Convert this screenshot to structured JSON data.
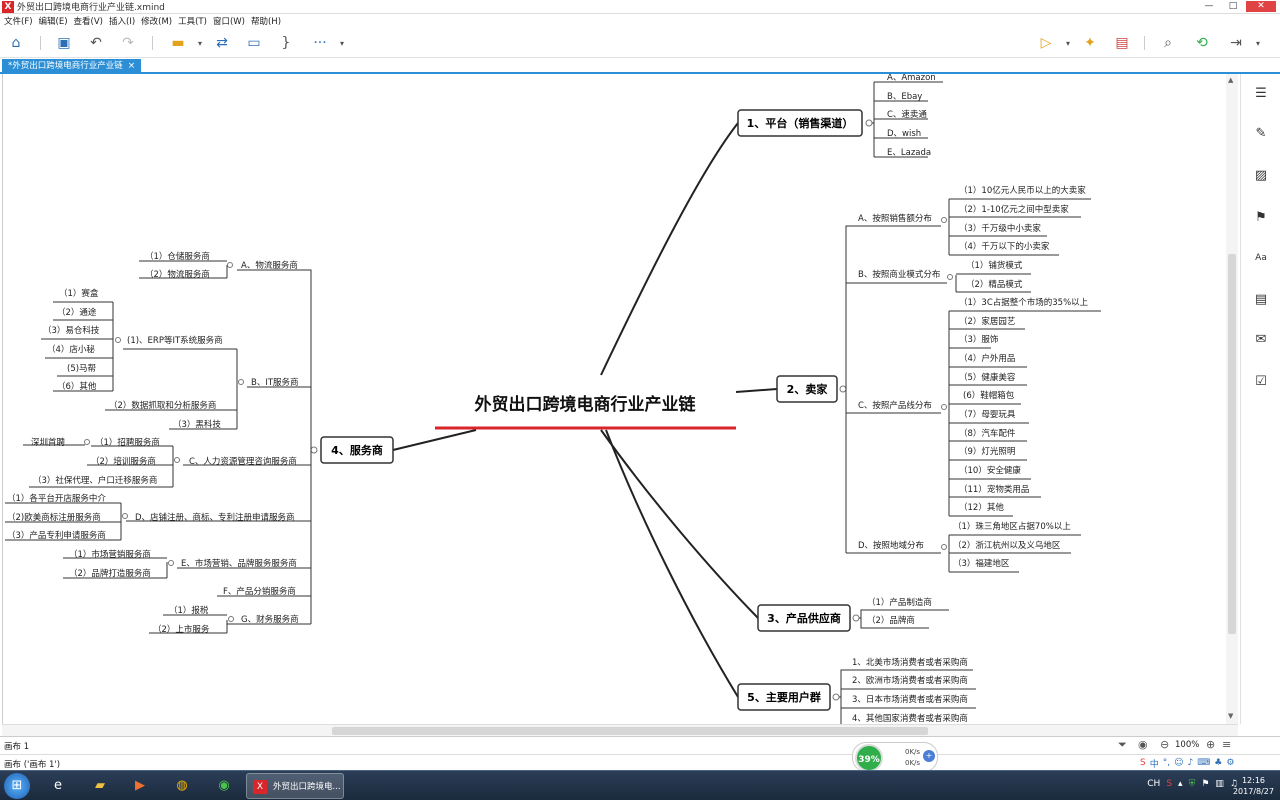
{
  "window": {
    "title": "外贸出口跨境电商行业产业链.xmind",
    "app_icon": "X"
  },
  "menu": [
    "文件(F)",
    "编辑(E)",
    "查看(V)",
    "插入(I)",
    "修改(M)",
    "工具(T)",
    "窗口(W)",
    "帮助(H)"
  ],
  "tab": {
    "label": "*外贸出口跨境电商行业产业链",
    "close": "×"
  },
  "mindmap": {
    "central": "外贸出口跨境电商行业产业链",
    "b1": {
      "label": "1、平台（销售渠道）",
      "items": [
        "A、Amazon",
        "B、Ebay",
        "C、速卖通",
        "D、wish",
        "E、Lazada"
      ]
    },
    "b2": {
      "label": "2、卖家",
      "a": {
        "label": "A、按照销售额分布",
        "items": [
          "（1）10亿元人民币以上的大卖家",
          "（2）1-10亿元之间中型卖家",
          "（3）千万级中小卖家",
          "（4）千万以下的小卖家"
        ]
      },
      "b": {
        "label": "B、按照商业模式分布",
        "items": [
          "（1）铺货模式",
          "（2）精品模式"
        ]
      },
      "c": {
        "label": "C、按照产品线分布",
        "items": [
          "（1）3C占据整个市场的35%以上",
          "（2）家居园艺",
          "（3）服饰",
          "（4）户外用品",
          "（5）健康美容",
          "(6）鞋帽箱包",
          "（7）母婴玩具",
          "（8）汽车配件",
          "（9）灯光照明",
          "（10）安全健康",
          "（11）宠物类用品",
          "（12）其他"
        ]
      },
      "d": {
        "label": "D、按照地域分布",
        "items": [
          "（1）珠三角地区占据70%以上",
          "（2）浙江杭州以及义乌地区",
          "（3）福建地区"
        ]
      }
    },
    "b3": {
      "label": "3、产品供应商",
      "items": [
        "（1）产品制造商",
        "（2）品牌商"
      ]
    },
    "b4": {
      "label": "4、服务商",
      "a": {
        "label": "A、物流服务商",
        "items": [
          "（1）仓储服务商",
          "（2）物流服务商"
        ]
      },
      "b": {
        "label": "B、IT服务商",
        "erp": {
          "label": "(1)、ERP等IT系统服务商",
          "items": [
            "（1）赛盒",
            "（2）通途",
            "（3）易仓科技",
            "（4）店小秘",
            "(5)马帮",
            "（6）其他"
          ]
        },
        "items": [
          "（2）数据抓取和分析服务商",
          "（3）黑科技"
        ]
      },
      "c": {
        "label": "C、人力资源管理咨询服务商",
        "items": [
          "（1）招聘服务商",
          "（2）培训服务商",
          "（3）社保代理、户口迁移服务商"
        ],
        "note": "深圳首聘"
      },
      "d": {
        "label": "D、店铺注册、商标、专利注册申请服务商",
        "items": [
          "（1）各平台开店服务中介",
          "（2)欧美商标注册服务商",
          "（3）产品专利申请服务商"
        ]
      },
      "e": {
        "label": "E、市场营销、品牌服务服务商",
        "items": [
          "（1）市场营销服务商",
          "（2）品牌打造服务商"
        ]
      },
      "f": {
        "label": "F、产品分销服务商"
      },
      "g": {
        "label": "G、财务服务商",
        "items": [
          "（1）报税",
          "（2）上市服务"
        ]
      }
    },
    "b5": {
      "label": "5、主要用户群",
      "items": [
        "1、北美市场消费者或者采购商",
        "2、欧洲市场消费者或者采购商",
        "3、日本市场消费者或者采购商",
        "4、其他国家消费者或者采购商"
      ]
    }
  },
  "statusbar": {
    "sheet": "画布 1",
    "zoom": "100%"
  },
  "infobar": "画布 ('画布 1')",
  "network": {
    "percent": "39%",
    "up": "0K/s",
    "down": "0K/s"
  },
  "taskbar": {
    "task_label": "外贸出口跨境电...",
    "time": "12:16",
    "date": "2017/8/27",
    "tray": "CH"
  },
  "colors": {
    "accent": "#2c8fd6",
    "central_underline": "#d9262b",
    "net_green": "#2fae4a"
  }
}
